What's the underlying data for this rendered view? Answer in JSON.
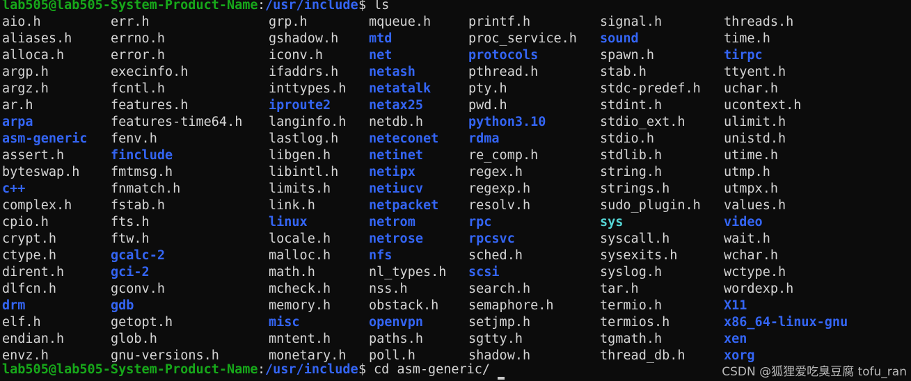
{
  "terminal": {
    "background_color": "#0c0c0c",
    "file_color": "#d5d5d5",
    "dir_color": "#3465f4",
    "link_color": "#56d6d6",
    "prompt_user_color": "#17a81a",
    "prompt_path_color": "#3465f4",
    "char_width": 11.13,
    "line_height": 24,
    "column_x": [
      3,
      159,
      386,
      530,
      673,
      862,
      1040
    ]
  },
  "prompt_top": {
    "user_host": "lab505@lab505-System-Product-Name",
    "separator": ":",
    "path": "/usr/include",
    "sigil": "$ ",
    "command": "ls"
  },
  "prompt_bottom": {
    "user_host": "lab505@lab505-System-Product-Name",
    "separator": ":",
    "path": "/usr/include",
    "sigil": "$ ",
    "command": "cd asm-generic/"
  },
  "listing": {
    "columns": [
      {
        "index": 0,
        "entries": [
          {
            "name": "aio.h",
            "type": "file"
          },
          {
            "name": "aliases.h",
            "type": "file"
          },
          {
            "name": "alloca.h",
            "type": "file"
          },
          {
            "name": "argp.h",
            "type": "file"
          },
          {
            "name": "argz.h",
            "type": "file"
          },
          {
            "name": "ar.h",
            "type": "file"
          },
          {
            "name": "arpa",
            "type": "dir"
          },
          {
            "name": "asm-generic",
            "type": "dir"
          },
          {
            "name": "assert.h",
            "type": "file"
          },
          {
            "name": "byteswap.h",
            "type": "file"
          },
          {
            "name": "c++",
            "type": "dir"
          },
          {
            "name": "complex.h",
            "type": "file"
          },
          {
            "name": "cpio.h",
            "type": "file"
          },
          {
            "name": "crypt.h",
            "type": "file"
          },
          {
            "name": "ctype.h",
            "type": "file"
          },
          {
            "name": "dirent.h",
            "type": "file"
          },
          {
            "name": "dlfcn.h",
            "type": "file"
          },
          {
            "name": "drm",
            "type": "dir"
          },
          {
            "name": "elf.h",
            "type": "file"
          },
          {
            "name": "endian.h",
            "type": "file"
          },
          {
            "name": "envz.h",
            "type": "file"
          }
        ]
      },
      {
        "index": 1,
        "entries": [
          {
            "name": "err.h",
            "type": "file"
          },
          {
            "name": "errno.h",
            "type": "file"
          },
          {
            "name": "error.h",
            "type": "file"
          },
          {
            "name": "execinfo.h",
            "type": "file"
          },
          {
            "name": "fcntl.h",
            "type": "file"
          },
          {
            "name": "features.h",
            "type": "file"
          },
          {
            "name": "features-time64.h",
            "type": "file"
          },
          {
            "name": "fenv.h",
            "type": "file"
          },
          {
            "name": "finclude",
            "type": "dir"
          },
          {
            "name": "fmtmsg.h",
            "type": "file"
          },
          {
            "name": "fnmatch.h",
            "type": "file"
          },
          {
            "name": "fstab.h",
            "type": "file"
          },
          {
            "name": "fts.h",
            "type": "file"
          },
          {
            "name": "ftw.h",
            "type": "file"
          },
          {
            "name": "gcalc-2",
            "type": "dir"
          },
          {
            "name": "gci-2",
            "type": "dir"
          },
          {
            "name": "gconv.h",
            "type": "file"
          },
          {
            "name": "gdb",
            "type": "dir"
          },
          {
            "name": "getopt.h",
            "type": "file"
          },
          {
            "name": "glob.h",
            "type": "file"
          },
          {
            "name": "gnu-versions.h",
            "type": "file"
          }
        ]
      },
      {
        "index": 2,
        "entries": [
          {
            "name": "grp.h",
            "type": "file"
          },
          {
            "name": "gshadow.h",
            "type": "file"
          },
          {
            "name": "iconv.h",
            "type": "file"
          },
          {
            "name": "ifaddrs.h",
            "type": "file"
          },
          {
            "name": "inttypes.h",
            "type": "file"
          },
          {
            "name": "iproute2",
            "type": "dir"
          },
          {
            "name": "langinfo.h",
            "type": "file"
          },
          {
            "name": "lastlog.h",
            "type": "file"
          },
          {
            "name": "libgen.h",
            "type": "file"
          },
          {
            "name": "libintl.h",
            "type": "file"
          },
          {
            "name": "limits.h",
            "type": "file"
          },
          {
            "name": "link.h",
            "type": "file"
          },
          {
            "name": "linux",
            "type": "dir"
          },
          {
            "name": "locale.h",
            "type": "file"
          },
          {
            "name": "malloc.h",
            "type": "file"
          },
          {
            "name": "math.h",
            "type": "file"
          },
          {
            "name": "mcheck.h",
            "type": "file"
          },
          {
            "name": "memory.h",
            "type": "file"
          },
          {
            "name": "misc",
            "type": "dir"
          },
          {
            "name": "mntent.h",
            "type": "file"
          },
          {
            "name": "monetary.h",
            "type": "file"
          }
        ]
      },
      {
        "index": 3,
        "entries": [
          {
            "name": "mqueue.h",
            "type": "file"
          },
          {
            "name": "mtd",
            "type": "dir"
          },
          {
            "name": "net",
            "type": "dir"
          },
          {
            "name": "netash",
            "type": "dir"
          },
          {
            "name": "netatalk",
            "type": "dir"
          },
          {
            "name": "netax25",
            "type": "dir"
          },
          {
            "name": "netdb.h",
            "type": "file"
          },
          {
            "name": "neteconet",
            "type": "dir"
          },
          {
            "name": "netinet",
            "type": "dir"
          },
          {
            "name": "netipx",
            "type": "dir"
          },
          {
            "name": "netiucv",
            "type": "dir"
          },
          {
            "name": "netpacket",
            "type": "dir"
          },
          {
            "name": "netrom",
            "type": "dir"
          },
          {
            "name": "netrose",
            "type": "dir"
          },
          {
            "name": "nfs",
            "type": "dir"
          },
          {
            "name": "nl_types.h",
            "type": "file"
          },
          {
            "name": "nss.h",
            "type": "file"
          },
          {
            "name": "obstack.h",
            "type": "file"
          },
          {
            "name": "openvpn",
            "type": "dir"
          },
          {
            "name": "paths.h",
            "type": "file"
          },
          {
            "name": "poll.h",
            "type": "file"
          }
        ]
      },
      {
        "index": 4,
        "entries": [
          {
            "name": "printf.h",
            "type": "file"
          },
          {
            "name": "proc_service.h",
            "type": "file"
          },
          {
            "name": "protocols",
            "type": "dir"
          },
          {
            "name": "pthread.h",
            "type": "file"
          },
          {
            "name": "pty.h",
            "type": "file"
          },
          {
            "name": "pwd.h",
            "type": "file"
          },
          {
            "name": "python3.10",
            "type": "dir"
          },
          {
            "name": "rdma",
            "type": "dir"
          },
          {
            "name": "re_comp.h",
            "type": "file"
          },
          {
            "name": "regex.h",
            "type": "file"
          },
          {
            "name": "regexp.h",
            "type": "file"
          },
          {
            "name": "resolv.h",
            "type": "file"
          },
          {
            "name": "rpc",
            "type": "dir"
          },
          {
            "name": "rpcsvc",
            "type": "dir"
          },
          {
            "name": "sched.h",
            "type": "file"
          },
          {
            "name": "scsi",
            "type": "dir"
          },
          {
            "name": "search.h",
            "type": "file"
          },
          {
            "name": "semaphore.h",
            "type": "file"
          },
          {
            "name": "setjmp.h",
            "type": "file"
          },
          {
            "name": "sgtty.h",
            "type": "file"
          },
          {
            "name": "shadow.h",
            "type": "file"
          }
        ]
      },
      {
        "index": 5,
        "entries": [
          {
            "name": "signal.h",
            "type": "file"
          },
          {
            "name": "sound",
            "type": "dir"
          },
          {
            "name": "spawn.h",
            "type": "file"
          },
          {
            "name": "stab.h",
            "type": "file"
          },
          {
            "name": "stdc-predef.h",
            "type": "file"
          },
          {
            "name": "stdint.h",
            "type": "file"
          },
          {
            "name": "stdio_ext.h",
            "type": "file"
          },
          {
            "name": "stdio.h",
            "type": "file"
          },
          {
            "name": "stdlib.h",
            "type": "file"
          },
          {
            "name": "string.h",
            "type": "file"
          },
          {
            "name": "strings.h",
            "type": "file"
          },
          {
            "name": "sudo_plugin.h",
            "type": "file"
          },
          {
            "name": "sys",
            "type": "link"
          },
          {
            "name": "syscall.h",
            "type": "file"
          },
          {
            "name": "sysexits.h",
            "type": "file"
          },
          {
            "name": "syslog.h",
            "type": "file"
          },
          {
            "name": "tar.h",
            "type": "file"
          },
          {
            "name": "termio.h",
            "type": "file"
          },
          {
            "name": "termios.h",
            "type": "file"
          },
          {
            "name": "tgmath.h",
            "type": "file"
          },
          {
            "name": "thread_db.h",
            "type": "file"
          }
        ]
      },
      {
        "index": 6,
        "entries": [
          {
            "name": "threads.h",
            "type": "file"
          },
          {
            "name": "time.h",
            "type": "file"
          },
          {
            "name": "tirpc",
            "type": "dir"
          },
          {
            "name": "ttyent.h",
            "type": "file"
          },
          {
            "name": "uchar.h",
            "type": "file"
          },
          {
            "name": "ucontext.h",
            "type": "file"
          },
          {
            "name": "ulimit.h",
            "type": "file"
          },
          {
            "name": "unistd.h",
            "type": "file"
          },
          {
            "name": "utime.h",
            "type": "file"
          },
          {
            "name": "utmp.h",
            "type": "file"
          },
          {
            "name": "utmpx.h",
            "type": "file"
          },
          {
            "name": "values.h",
            "type": "file"
          },
          {
            "name": "video",
            "type": "dir"
          },
          {
            "name": "wait.h",
            "type": "file"
          },
          {
            "name": "wchar.h",
            "type": "file"
          },
          {
            "name": "wctype.h",
            "type": "file"
          },
          {
            "name": "wordexp.h",
            "type": "file"
          },
          {
            "name": "X11",
            "type": "dir"
          },
          {
            "name": "x86_64-linux-gnu",
            "type": "dir"
          },
          {
            "name": "xen",
            "type": "dir"
          },
          {
            "name": "xorg",
            "type": "dir"
          }
        ]
      }
    ]
  },
  "watermark": {
    "text": "CSDN @狐狸爱吃臭豆腐 tofu_ran"
  }
}
